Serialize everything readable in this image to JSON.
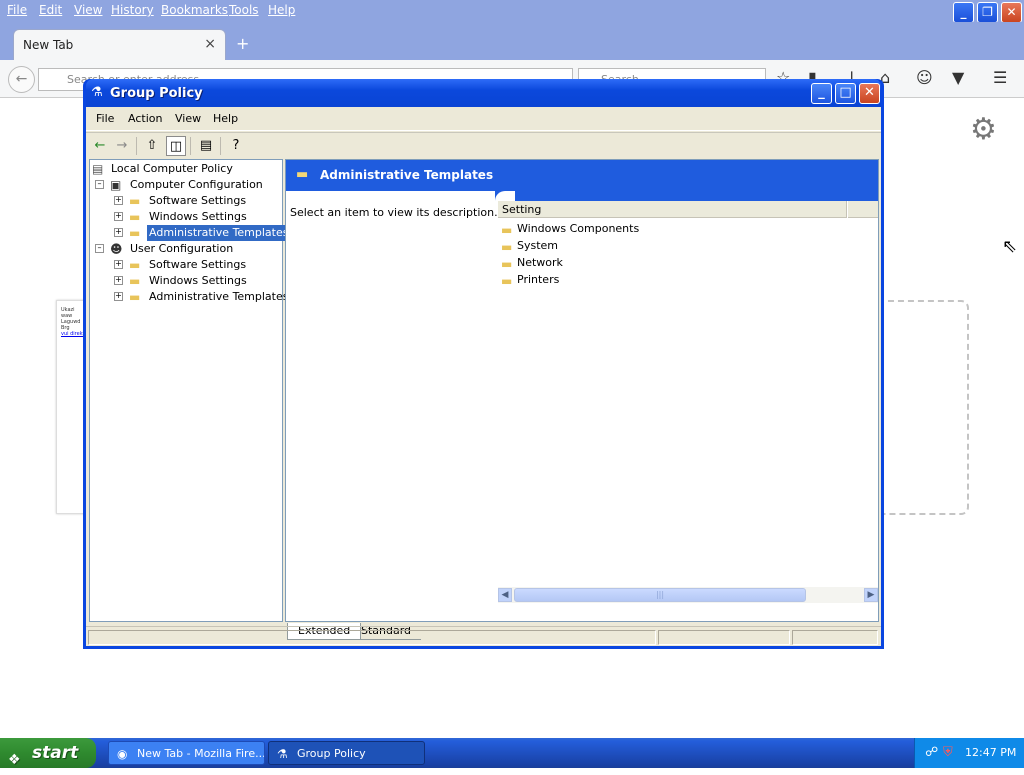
{
  "firefox": {
    "menu": [
      "File",
      "Edit",
      "View",
      "History",
      "Bookmarks",
      "Tools",
      "Help"
    ],
    "tab_title": "New Tab",
    "tab_close": "×",
    "new_tab": "+",
    "url_placeholder": "Search or enter address",
    "search_placeholder": "Search",
    "window_controls": [
      "_",
      "❐",
      "✕"
    ],
    "tile_text": [
      "Ukazi waw",
      "Laguwd Brg",
      "vui direkt"
    ]
  },
  "group_policy": {
    "title": "Group Policy",
    "menu": [
      "File",
      "Action",
      "View",
      "Help"
    ],
    "tree": {
      "root": "Local Computer Policy",
      "computer_config": "Computer Configuration",
      "computer_children": [
        "Software Settings",
        "Windows Settings",
        "Administrative Templates"
      ],
      "user_config": "User Configuration",
      "user_children": [
        "Software Settings",
        "Windows Settings",
        "Administrative Templates"
      ]
    },
    "banner_title": "Administrative Templates",
    "description": "Select an item to view its description.",
    "column_header": "Setting",
    "items": [
      "Windows Components",
      "System",
      "Network",
      "Printers"
    ],
    "tabs": [
      "Extended",
      "Standard"
    ]
  },
  "taskbar": {
    "start": "start",
    "tasks": [
      "New Tab - Mozilla Fire...",
      "Group Policy"
    ],
    "clock": "12:47 PM"
  },
  "icons": {
    "folder": "folder-icon",
    "gear": "gear-icon"
  }
}
